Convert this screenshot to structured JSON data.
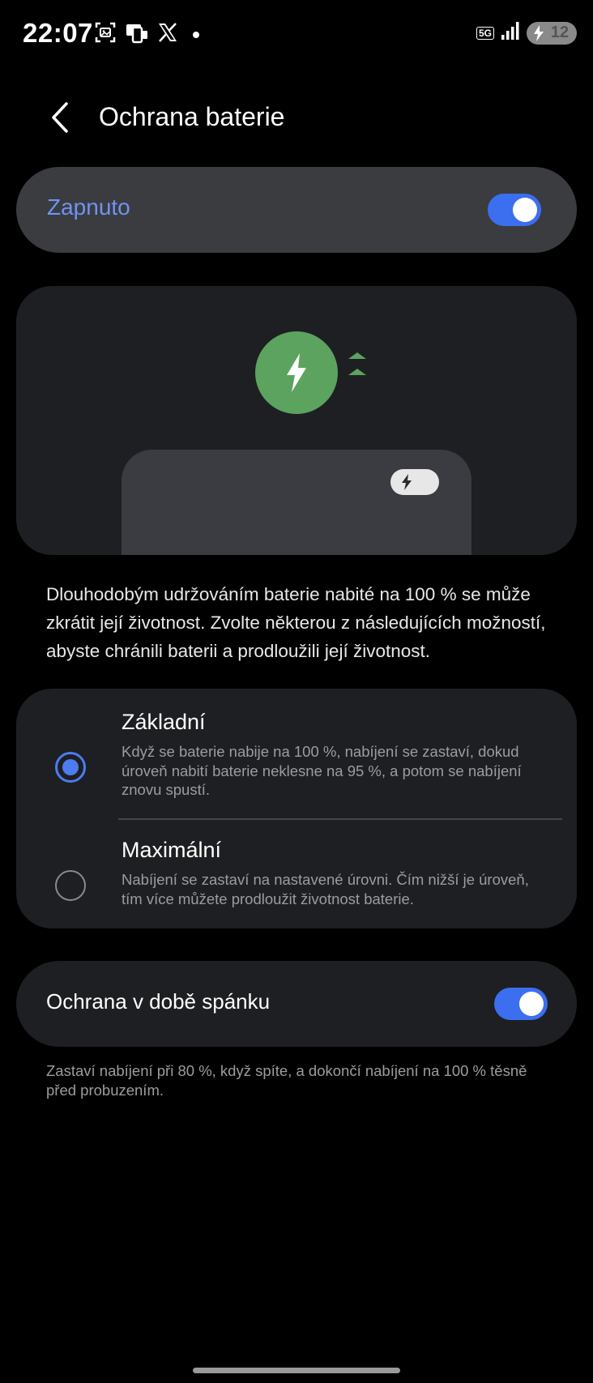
{
  "status_bar": {
    "time": "22:07",
    "network": "5G",
    "battery_level": "12",
    "icons": [
      "screenshot-icon",
      "cast-icon",
      "x-app-icon",
      "notification-dot-icon",
      "signal-icon",
      "charging-icon"
    ]
  },
  "header": {
    "title": "Ochrana baterie"
  },
  "master_toggle": {
    "label": "Zapnuto",
    "on": true
  },
  "description": "Dlouhodobým udržováním baterie nabité na 100 % se může zkrátit její životnost. Zvolte některou z následujících možností, abyste chránili baterii a prodloužili její životnost.",
  "options": [
    {
      "title": "Základní",
      "description": "Když se baterie nabije na 100 %, nabíjení se zastaví, dokud úroveň nabití baterie neklesne na 95 %, a potom se nabíjení znovu spustí.",
      "selected": true
    },
    {
      "title": "Maximální",
      "description": "Nabíjení se zastaví na nastavené úrovni. Čím nižší je úroveň, tím více můžete prodloužit životnost baterie.",
      "selected": false
    }
  ],
  "sleep_protection": {
    "label": "Ochrana v době spánku",
    "on": true,
    "description": "Zastaví nabíjení při 80 %, když spíte, a dokončí nabíjení na 100 % těsně před probuzením."
  },
  "colors": {
    "accent": "#3c6ef0",
    "accent_text": "#6f93f2",
    "charge_green": "#5ba35e",
    "card_bg": "#1e1f22",
    "master_card_bg": "#3b3c40"
  }
}
